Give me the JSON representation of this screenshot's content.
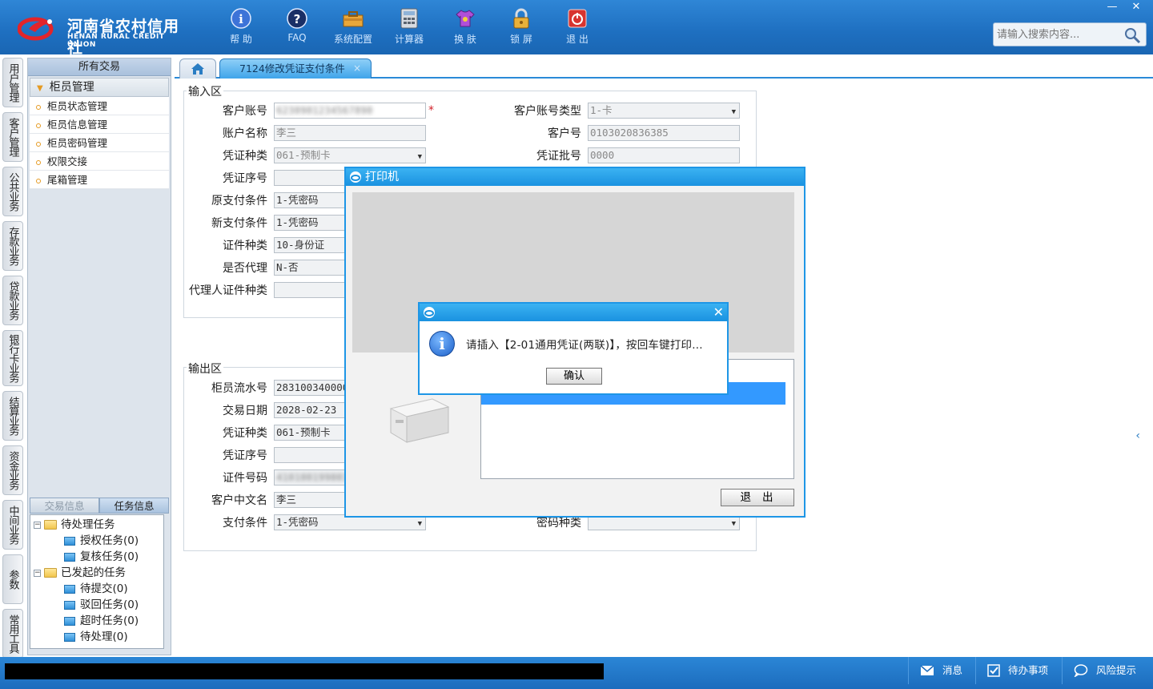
{
  "app": {
    "logo_cn": "河南省农村信用社",
    "logo_en": "HENAN RURAL CREDIT UNION",
    "toolbar": [
      {
        "label": "帮 助",
        "icon": "info-icon"
      },
      {
        "label": "FAQ",
        "icon": "question-icon"
      },
      {
        "label": "系统配置",
        "icon": "toolbox-icon"
      },
      {
        "label": "计算器",
        "icon": "calculator-icon"
      },
      {
        "label": "换 肤",
        "icon": "shirt-icon"
      },
      {
        "label": "锁 屏",
        "icon": "lock-icon"
      },
      {
        "label": "退 出",
        "icon": "power-icon"
      }
    ],
    "window": {
      "minimize": "—",
      "close": "✕"
    },
    "search": {
      "placeholder": "请输入搜索内容..."
    }
  },
  "vnav": [
    "用户管理",
    "客户管理",
    "公共业务",
    "存款业务",
    "贷款业务",
    "银行卡业务",
    "结算业务",
    "资金业务",
    "中间业务",
    "参数",
    "常用工具"
  ],
  "sidebar": {
    "header": "所有交易",
    "section": "柜员管理",
    "items": [
      "柜员状态管理",
      "柜员信息管理",
      "柜员密码管理",
      "权限交接",
      "尾箱管理"
    ],
    "tabs": [
      "交易信息",
      "任务信息"
    ],
    "tree": {
      "pending": "待处理任务",
      "auth": "授权任务(0)",
      "review": "复核任务(0)",
      "initiated": "已发起的任务",
      "tosubmit": "待提交(0)",
      "rejected": "驳回任务(0)",
      "timeout": "超时任务(0)",
      "todo": "待处理(0)"
    }
  },
  "tab": {
    "title": "7124修改凭证支付条件",
    "close": "×"
  },
  "input_area": {
    "legend": "输入区",
    "fields": {
      "acct_no": {
        "label": "客户账号",
        "value": "6230901234567890"
      },
      "acct_type": {
        "label": "客户账号类型",
        "value": "1-卡"
      },
      "acct_name": {
        "label": "账户名称",
        "value": "李三"
      },
      "cust_no": {
        "label": "客户号",
        "value": "0103020836385"
      },
      "voucher_type": {
        "label": "凭证种类",
        "value": "061-预制卡"
      },
      "voucher_batch": {
        "label": "凭证批号",
        "value": "0000"
      },
      "voucher_seq": {
        "label": "凭证序号",
        "value": ""
      },
      "old_pay": {
        "label": "原支付条件",
        "value": "1-凭密码"
      },
      "new_pay": {
        "label": "新支付条件",
        "value": "1-凭密码"
      },
      "id_type": {
        "label": "证件种类",
        "value": "10-身份证"
      },
      "agent": {
        "label": "是否代理",
        "value": "N-否"
      },
      "agent_id_type": {
        "label": "代理人证件种类",
        "value": ""
      }
    }
  },
  "output_area": {
    "legend": "输出区",
    "fields": {
      "teller_seq": {
        "label": "柜员流水号",
        "value": "283100340000"
      },
      "txn_date": {
        "label": "交易日期",
        "value": "2028-02-23"
      },
      "voucher_type": {
        "label": "凭证种类",
        "value": "061-预制卡"
      },
      "voucher_seq": {
        "label": "凭证序号",
        "value": ""
      },
      "id_no": {
        "label": "证件号码",
        "value": "410100199001011234"
      },
      "cust_cn_name": {
        "label": "客户中文名",
        "value": "李三"
      },
      "pay_cond": {
        "label": "支付条件",
        "value": "1-凭密码"
      },
      "pwd_type": {
        "label": "密码种类",
        "value": ""
      }
    }
  },
  "printer_dialog": {
    "title": "打印机",
    "exit": "退出"
  },
  "message_box": {
    "text": "请插入【2-01通用凭证(两联)】，按回车键打印...",
    "ok": "确认",
    "close": "✕"
  },
  "statusbar": {
    "messages": "消息",
    "todo": "待办事项",
    "risk": "风险提示"
  }
}
